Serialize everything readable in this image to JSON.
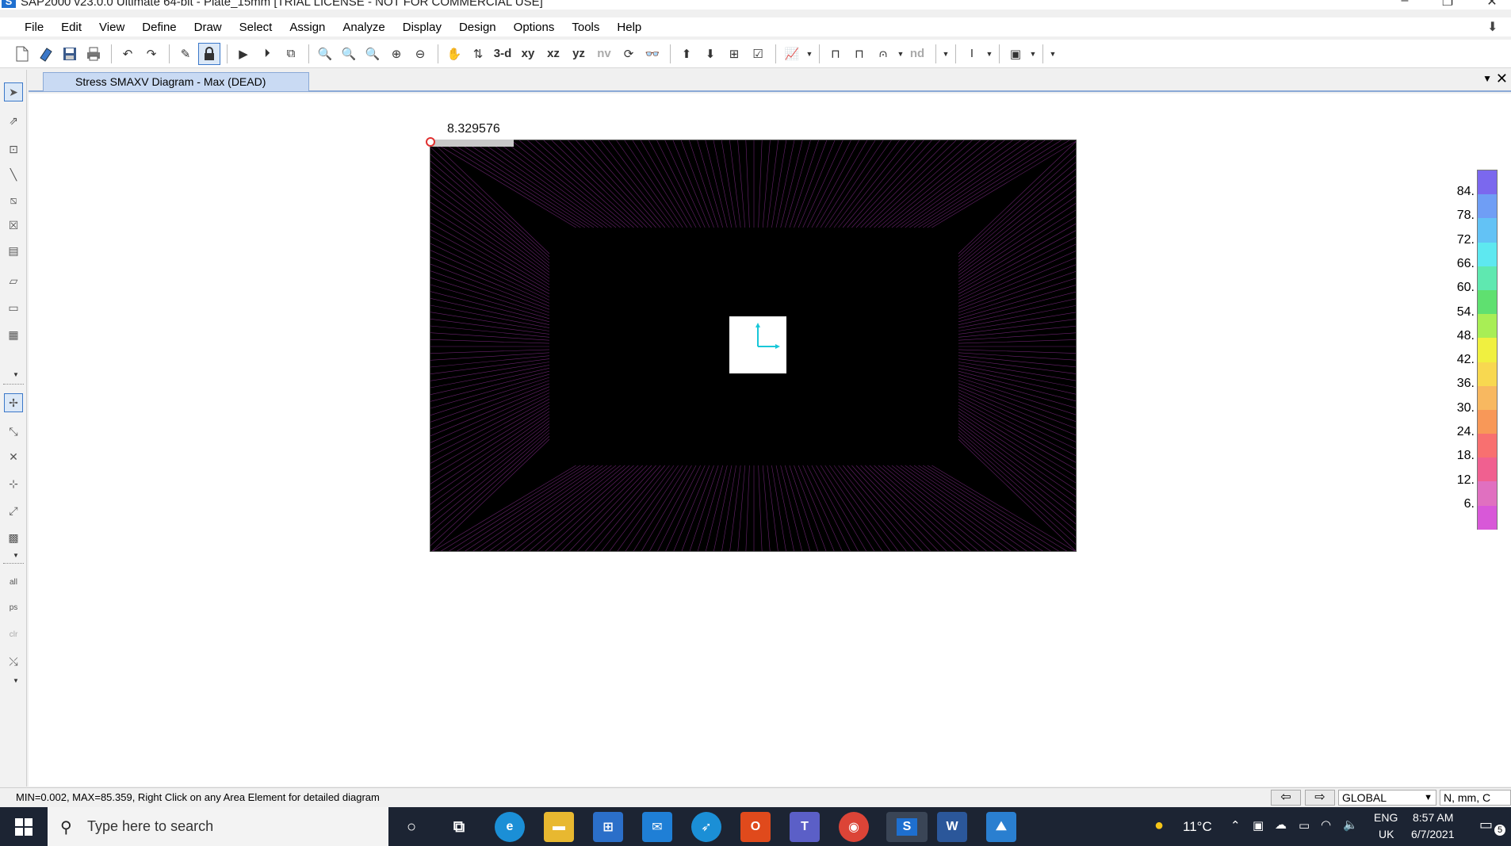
{
  "window": {
    "app_icon": "S",
    "title": "SAP2000 v23.0.0 Ultimate 64-bit - Plate_15mm [TRIAL LICENSE - NOT FOR COMMERCIAL USE]",
    "controls": {
      "minimize": "–",
      "restore": "❐",
      "close": "✕"
    }
  },
  "menu": [
    "File",
    "Edit",
    "View",
    "Define",
    "Draw",
    "Select",
    "Assign",
    "Analyze",
    "Display",
    "Design",
    "Options",
    "Tools",
    "Help"
  ],
  "toolbar": {
    "view_3d": "3-d",
    "view_xy": "xy",
    "view_xz": "xz",
    "view_yz": "yz",
    "view_nv": "nv",
    "nd": "nd"
  },
  "tab": {
    "label": "Stress SMAXV Diagram - Max   (DEAD)"
  },
  "diagram": {
    "max_value_label": "8.329576",
    "colors": {
      "background": "#000000",
      "stress_lines": "#c040c8",
      "marker": "#e03030"
    }
  },
  "legend": {
    "labels": [
      "84.",
      "78.",
      "72.",
      "66.",
      "60.",
      "54.",
      "48.",
      "42.",
      "36.",
      "30.",
      "24.",
      "18.",
      "12.",
      "6."
    ],
    "colors": [
      "#7b68ee",
      "#6f9ef5",
      "#63c2f5",
      "#5ee8f0",
      "#5fe8b0",
      "#5fe070",
      "#a8ee55",
      "#f0f040",
      "#f8d850",
      "#f8b860",
      "#f89858",
      "#f87070",
      "#f06090",
      "#e070c0",
      "#d858d8"
    ]
  },
  "status": {
    "message": "MIN=0.002, MAX=85.359, Right Click on any Area Element for detailed diagram",
    "coord_system": "GLOBAL",
    "units": "N, mm, C"
  },
  "taskbar": {
    "search_placeholder": "Type here to search",
    "weather": "11°C",
    "lang_line1": "ENG",
    "lang_line2": "UK",
    "time": "8:57 AM",
    "date": "6/7/2021",
    "notifications": "5"
  }
}
